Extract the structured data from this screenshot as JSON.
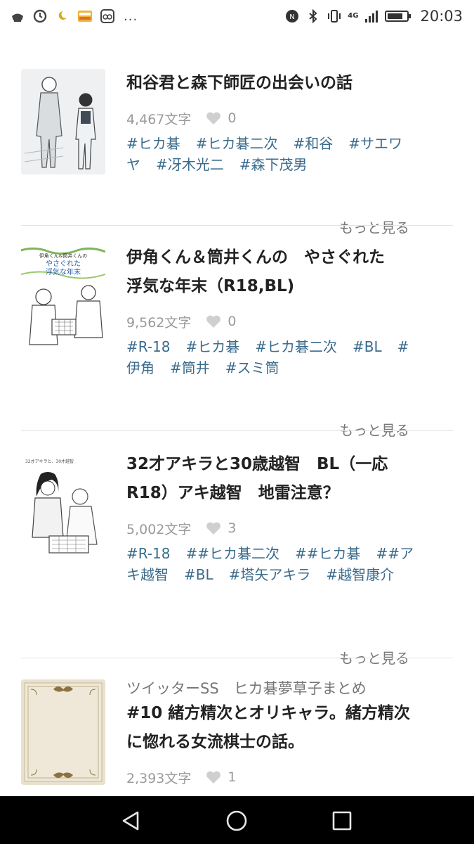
{
  "status_bar": {
    "time": "20:03",
    "network": "4G",
    "left_icons": [
      "app-icon",
      "alarm-icon",
      "moon-icon",
      "app-badge-icon",
      "app-icon-2"
    ],
    "more": "..."
  },
  "works": [
    {
      "series": "",
      "title": "和谷君と森下師匠の出会いの話",
      "chars": "4,467文字",
      "likes": "0",
      "tags": [
        "#ヒカ碁",
        "#ヒカ碁二次",
        "#和谷",
        "#サエワヤ",
        "#冴木光二",
        "#森下茂男"
      ],
      "more": "もっと見る"
    },
    {
      "series": "",
      "title": "伊角くん＆筒井くんの　やさぐれた　浮気な年末（R18,BL)",
      "chars": "9,562文字",
      "likes": "0",
      "tags": [
        "#R-18",
        "#ヒカ碁",
        "#ヒカ碁二次",
        "#BL",
        "#伊角",
        "#筒井",
        "#スミ筒"
      ],
      "more": "もっと見る"
    },
    {
      "series": "",
      "title": "32才アキラと30歳越智　BL（一応R18）アキ越智　地雷注意？",
      "chars": "5,002文字",
      "likes": "3",
      "tags": [
        "#R-18",
        "##ヒカ碁二次",
        "##ヒカ碁",
        "##アキ越智",
        "#BL",
        "#塔矢アキラ",
        "#越智康介"
      ],
      "more": "もっと見る"
    },
    {
      "series": "ツイッターSS　ヒカ碁夢草子まとめ",
      "title": "#10 緒方精次とオリキャラ。緒方精次に惚れる女流棋士の話。",
      "chars": "2,393文字",
      "likes": "1",
      "tags": [],
      "more": ""
    }
  ],
  "thumbnails": {
    "cover2_caption": "伊角くん＆筒井くんの やさぐれた 浮気な年末",
    "cover3_caption": "32才アキラと、30才越智"
  },
  "colors": {
    "tag": "#3a6b8c",
    "meta": "#9a9a9a",
    "divider": "#e3e3e3",
    "nav_bg": "#000000"
  },
  "nav": [
    "back-icon",
    "home-icon",
    "recents-icon"
  ]
}
